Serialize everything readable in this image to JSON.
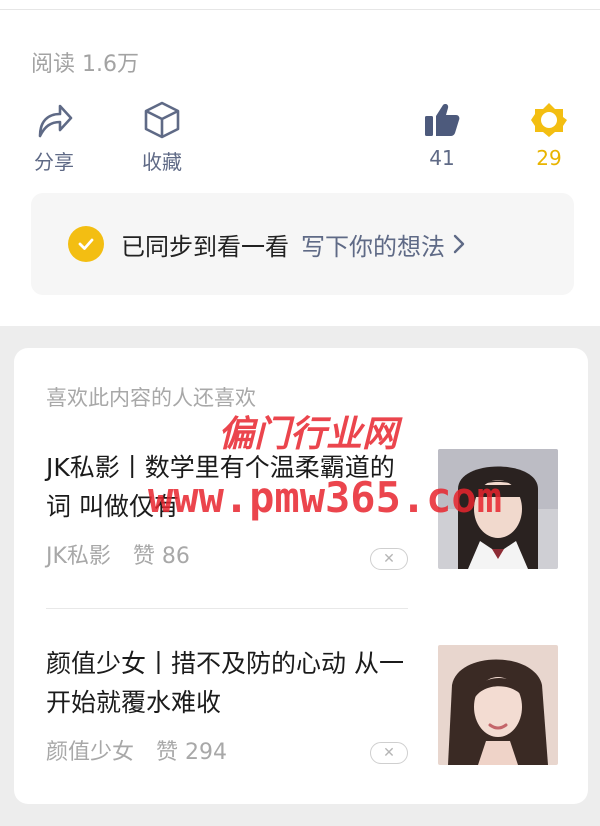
{
  "stats": {
    "read_count": "阅读 1.6万"
  },
  "actions": {
    "share": "分享",
    "favorite": "收藏",
    "like_count": "41",
    "wow_count": "29"
  },
  "sync": {
    "status": "已同步到看一看",
    "write_prompt": "写下你的想法"
  },
  "recommendations": {
    "heading": "喜欢此内容的人还喜欢",
    "items": [
      {
        "title": "JK私影丨数学里有个温柔霸道的词 叫做仅有",
        "source": "JK私影",
        "likes": "赞 86"
      },
      {
        "title": "颜值少女丨措不及防的心动 从一开始就覆水难收",
        "source": "颜值少女",
        "likes": "赞 294"
      }
    ]
  },
  "watermark": {
    "line1": "偏门行业网",
    "line2": "www.pmw365.com"
  },
  "colors": {
    "accent_yellow": "#f3be12",
    "link_slate": "#5f6a86",
    "watermark_red": "#e8252e"
  }
}
